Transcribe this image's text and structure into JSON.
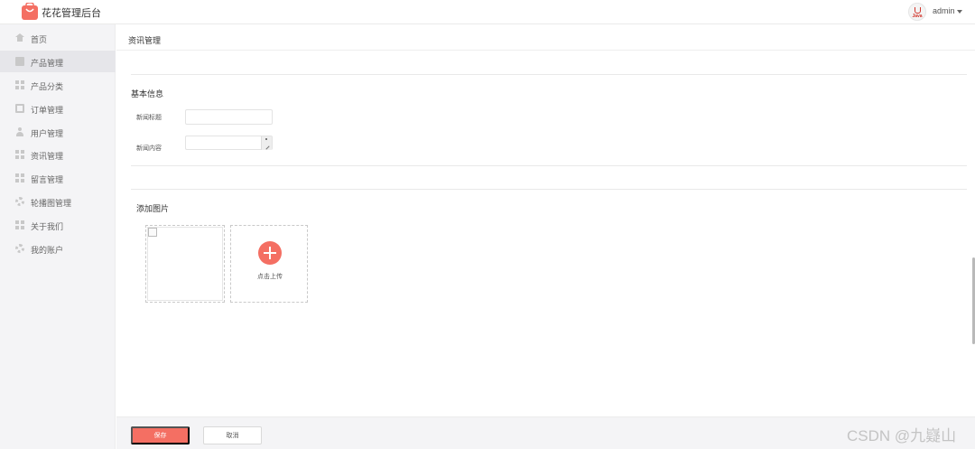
{
  "app": {
    "title": "花花管理后台"
  },
  "user": {
    "name": "admin",
    "avatar_badge": "Java"
  },
  "sidebar": {
    "items": [
      {
        "label": "首页",
        "icon": "home-icon",
        "active": false
      },
      {
        "label": "产品管理",
        "icon": "product-icon",
        "active": true
      },
      {
        "label": "产品分类",
        "icon": "grid-icon",
        "active": false
      },
      {
        "label": "订单管理",
        "icon": "document-icon",
        "active": false
      },
      {
        "label": "用户管理",
        "icon": "user-icon",
        "active": false
      },
      {
        "label": "资讯管理",
        "icon": "grid-icon",
        "active": false
      },
      {
        "label": "留言管理",
        "icon": "grid-icon",
        "active": false
      },
      {
        "label": "轮播图管理",
        "icon": "gear-icon",
        "active": false
      },
      {
        "label": "关于我们",
        "icon": "grid-icon",
        "active": false
      },
      {
        "label": "我的账户",
        "icon": "gear-icon",
        "active": false
      }
    ]
  },
  "main": {
    "page_title": "资讯管理",
    "basic_info": {
      "title": "基本信息",
      "news_title_label": "新闻标题",
      "news_title_value": "",
      "news_content_label": "新闻内容",
      "news_content_value": ""
    },
    "images": {
      "title": "添加图片",
      "upload_label": "点击上传"
    }
  },
  "footer": {
    "save_label": "保存",
    "cancel_label": "取消"
  },
  "watermark": "CSDN @九嶷山",
  "colors": {
    "accent": "#f46f63",
    "sidebar_bg": "#f4f4f6",
    "active_item_bg": "#e6e6ea"
  }
}
